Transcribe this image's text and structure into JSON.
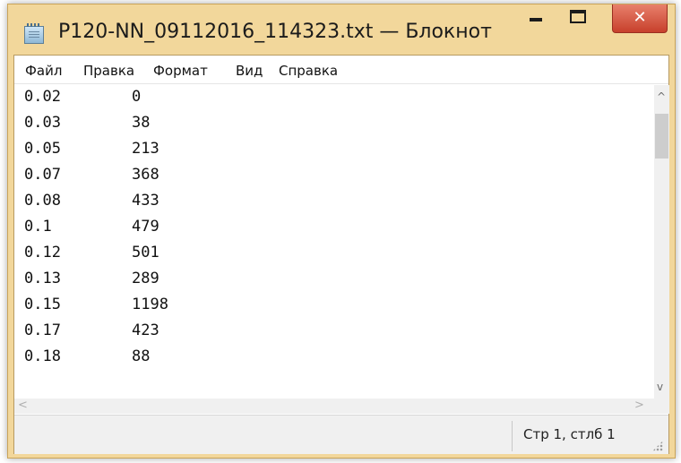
{
  "window": {
    "title": "P120-NN_09112016_114323.txt — Блокнот",
    "close_label": "✕",
    "titlebar_color": "#f2d79b",
    "close_color": "#d5533d"
  },
  "menu": {
    "file": "Файл",
    "edit": "Правка",
    "format": "Формат",
    "view": "Вид",
    "help": "Справка"
  },
  "document": {
    "lines": [
      {
        "c1": "0.02",
        "c2": "0"
      },
      {
        "c1": "0.03",
        "c2": "38"
      },
      {
        "c1": "0.05",
        "c2": "213"
      },
      {
        "c1": "0.07",
        "c2": "368"
      },
      {
        "c1": "0.08",
        "c2": "433"
      },
      {
        "c1": "0.1",
        "c2": "479"
      },
      {
        "c1": "0.12",
        "c2": "501"
      },
      {
        "c1": "0.13",
        "c2": "289"
      },
      {
        "c1": "0.15",
        "c2": "1198"
      },
      {
        "c1": "0.17",
        "c2": "423"
      },
      {
        "c1": "0.18",
        "c2": "88"
      }
    ]
  },
  "scrollbars": {
    "up": "^",
    "down": "v",
    "left": "<",
    "right": ">"
  },
  "status": {
    "position": "Стр 1, стлб 1"
  }
}
